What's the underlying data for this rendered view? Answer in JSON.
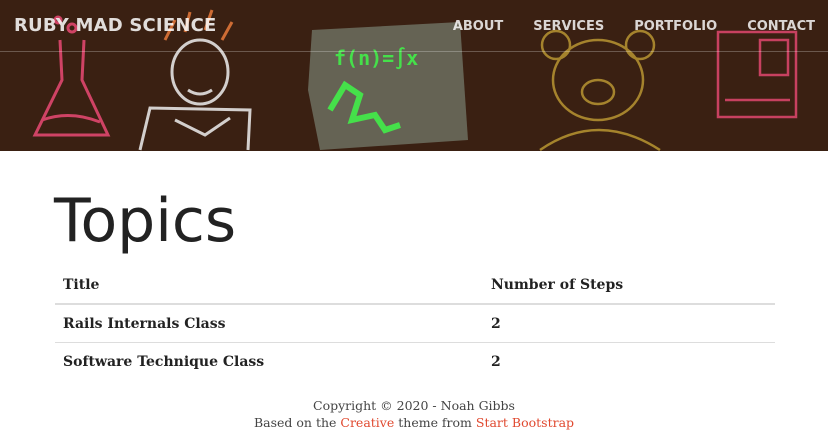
{
  "navbar": {
    "brand": "RUBY MAD SCIENCE",
    "links": [
      "ABOUT",
      "SERVICES",
      "PORTFOLIO",
      "CONTACT"
    ]
  },
  "hero": {
    "chalk_formula": "f(n)=∫x",
    "icons": [
      "flask-drawing-icon",
      "scientist-drawing-icon",
      "chalkboard-icon",
      "teddy-bear-drawing-icon",
      "computer-drawing-icon"
    ]
  },
  "page": {
    "title": "Topics"
  },
  "table": {
    "headers": [
      "Title",
      "Number of Steps"
    ],
    "rows": [
      {
        "title": "Rails Internals Class",
        "steps": "2"
      },
      {
        "title": "Software Technique Class",
        "steps": "2"
      }
    ]
  },
  "footer": {
    "copyright": "Copyright © 2020 - Noah Gibbs",
    "based_prefix": "Based on the ",
    "creative_link": "Creative",
    "theme_middle": " theme from ",
    "bootstrap_link": "Start Bootstrap"
  },
  "colors": {
    "hero_bg": "#3a2012",
    "link_accent": "#e0482e"
  }
}
